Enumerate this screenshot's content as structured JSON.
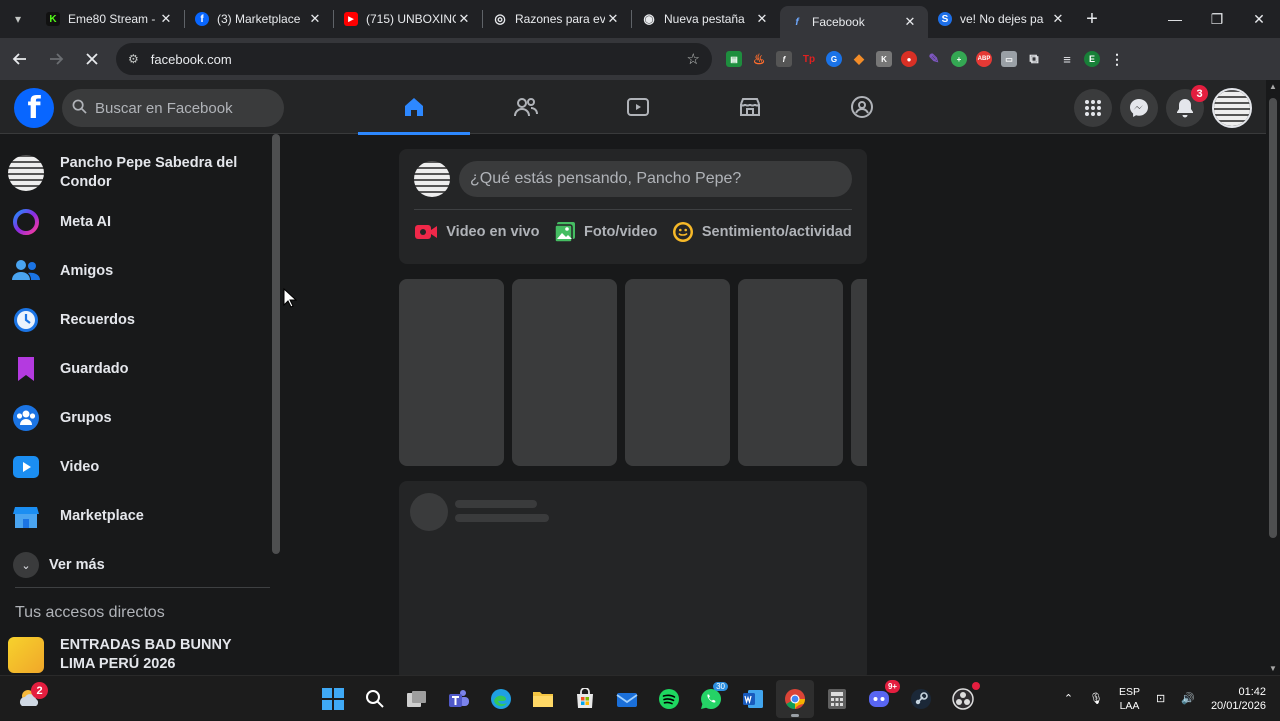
{
  "browser": {
    "tabs": [
      {
        "title": "Eme80 Stream -",
        "favicon_color": "#53fc18",
        "favicon_letter": "K"
      },
      {
        "title": "(3) Marketplace",
        "favicon_color": "#0866ff",
        "favicon_letter": "f"
      },
      {
        "title": "(715) UNBOXING",
        "favicon_color": "#ff0000",
        "favicon_letter": "▶"
      },
      {
        "title": "Razones para ev",
        "favicon_color": "#5f6368",
        "favicon_letter": "◎"
      },
      {
        "title": "Nueva pestaña",
        "favicon_color": "#5f6368",
        "favicon_letter": "◉"
      },
      {
        "title": "Facebook",
        "favicon_color": "#0866ff",
        "favicon_letter": "f"
      },
      {
        "title": "ve! No dejes pa",
        "favicon_color": "#1d6fe8",
        "favicon_letter": "S"
      }
    ],
    "url": "facebook.com",
    "profile_letter": "E"
  },
  "facebook": {
    "search_placeholder": "Buscar en Facebook",
    "notification_count": "3",
    "sidebar": {
      "profile_name": "Pancho Pepe Sabedra del Condor",
      "items": [
        {
          "label": "Meta AI"
        },
        {
          "label": "Amigos"
        },
        {
          "label": "Recuerdos"
        },
        {
          "label": "Guardado"
        },
        {
          "label": "Grupos"
        },
        {
          "label": "Video"
        },
        {
          "label": "Marketplace"
        }
      ],
      "more_label": "Ver más",
      "shortcuts_title": "Tus accesos directos",
      "shortcut": "ENTRADAS BAD BUNNY LIMA PERÚ 2026"
    },
    "composer": {
      "placeholder": "¿Qué estás pensando, Pancho Pepe?",
      "actions": [
        "Video en vivo",
        "Foto/video",
        "Sentimiento/actividad"
      ]
    }
  },
  "taskbar": {
    "weather_badge": "2",
    "whatsapp_badge": "30",
    "discord_badge": "9+",
    "lang_line1": "ESP",
    "lang_line2": "LAA",
    "time": "01:42",
    "date": "20/01/2026"
  }
}
